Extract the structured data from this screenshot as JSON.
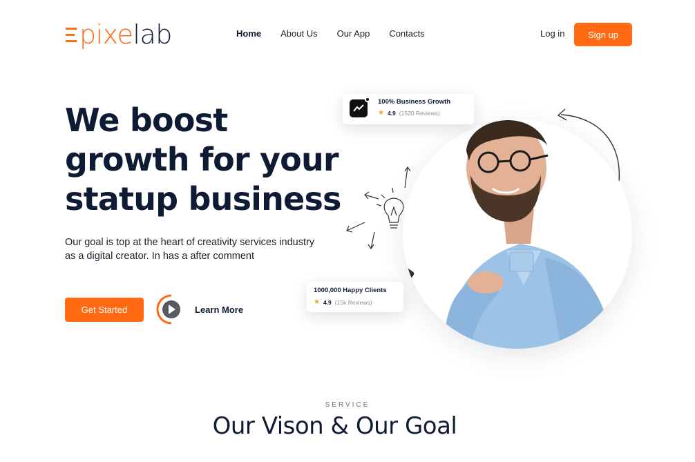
{
  "brand": {
    "logo_e": "E",
    "logo_pixel": "pixe",
    "logo_lab": "lab",
    "accent_color": "#ff6a13",
    "navy_color": "#0f1b35"
  },
  "nav": {
    "items": [
      {
        "label": "Home",
        "active": true
      },
      {
        "label": "About Us",
        "active": false
      },
      {
        "label": "Our App",
        "active": false
      },
      {
        "label": "Contacts",
        "active": false
      }
    ],
    "login_label": "Log in",
    "signup_label": "Sign up"
  },
  "hero": {
    "title_line1": "We boost",
    "title_line2": "growth for your",
    "title_line3": "statup business",
    "subtitle_line1": "Our goal is top at the heart of creativity services industry",
    "subtitle_line2": "as a digital creator. In has a after comment",
    "cta_label": "Get Started",
    "learn_label": "Learn More"
  },
  "cards": {
    "growth": {
      "title": "100% Business Growth",
      "score": "4.9",
      "reviews": "(1520 Reviews)",
      "icon": "trend-up-icon"
    },
    "clients": {
      "title": "1000,000 Happy Clients",
      "score": "4.9",
      "reviews": "(15k Reviews)"
    }
  },
  "service": {
    "kicker": "SERVICE",
    "title": "Our Vison & Our Goal"
  }
}
